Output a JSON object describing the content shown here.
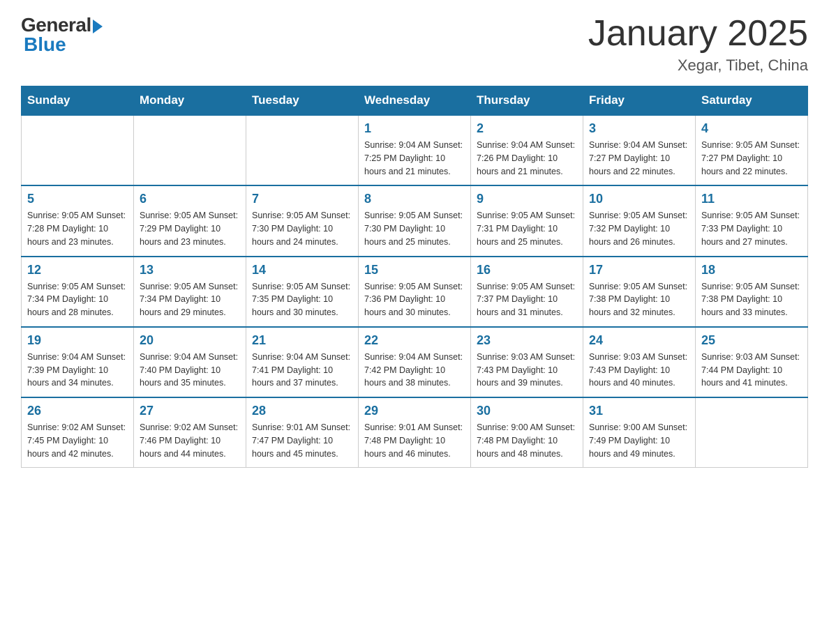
{
  "logo": {
    "general": "General",
    "blue": "Blue"
  },
  "title": "January 2025",
  "location": "Xegar, Tibet, China",
  "weekdays": [
    "Sunday",
    "Monday",
    "Tuesday",
    "Wednesday",
    "Thursday",
    "Friday",
    "Saturday"
  ],
  "weeks": [
    [
      {
        "day": "",
        "info": ""
      },
      {
        "day": "",
        "info": ""
      },
      {
        "day": "",
        "info": ""
      },
      {
        "day": "1",
        "info": "Sunrise: 9:04 AM\nSunset: 7:25 PM\nDaylight: 10 hours\nand 21 minutes."
      },
      {
        "day": "2",
        "info": "Sunrise: 9:04 AM\nSunset: 7:26 PM\nDaylight: 10 hours\nand 21 minutes."
      },
      {
        "day": "3",
        "info": "Sunrise: 9:04 AM\nSunset: 7:27 PM\nDaylight: 10 hours\nand 22 minutes."
      },
      {
        "day": "4",
        "info": "Sunrise: 9:05 AM\nSunset: 7:27 PM\nDaylight: 10 hours\nand 22 minutes."
      }
    ],
    [
      {
        "day": "5",
        "info": "Sunrise: 9:05 AM\nSunset: 7:28 PM\nDaylight: 10 hours\nand 23 minutes."
      },
      {
        "day": "6",
        "info": "Sunrise: 9:05 AM\nSunset: 7:29 PM\nDaylight: 10 hours\nand 23 minutes."
      },
      {
        "day": "7",
        "info": "Sunrise: 9:05 AM\nSunset: 7:30 PM\nDaylight: 10 hours\nand 24 minutes."
      },
      {
        "day": "8",
        "info": "Sunrise: 9:05 AM\nSunset: 7:30 PM\nDaylight: 10 hours\nand 25 minutes."
      },
      {
        "day": "9",
        "info": "Sunrise: 9:05 AM\nSunset: 7:31 PM\nDaylight: 10 hours\nand 25 minutes."
      },
      {
        "day": "10",
        "info": "Sunrise: 9:05 AM\nSunset: 7:32 PM\nDaylight: 10 hours\nand 26 minutes."
      },
      {
        "day": "11",
        "info": "Sunrise: 9:05 AM\nSunset: 7:33 PM\nDaylight: 10 hours\nand 27 minutes."
      }
    ],
    [
      {
        "day": "12",
        "info": "Sunrise: 9:05 AM\nSunset: 7:34 PM\nDaylight: 10 hours\nand 28 minutes."
      },
      {
        "day": "13",
        "info": "Sunrise: 9:05 AM\nSunset: 7:34 PM\nDaylight: 10 hours\nand 29 minutes."
      },
      {
        "day": "14",
        "info": "Sunrise: 9:05 AM\nSunset: 7:35 PM\nDaylight: 10 hours\nand 30 minutes."
      },
      {
        "day": "15",
        "info": "Sunrise: 9:05 AM\nSunset: 7:36 PM\nDaylight: 10 hours\nand 30 minutes."
      },
      {
        "day": "16",
        "info": "Sunrise: 9:05 AM\nSunset: 7:37 PM\nDaylight: 10 hours\nand 31 minutes."
      },
      {
        "day": "17",
        "info": "Sunrise: 9:05 AM\nSunset: 7:38 PM\nDaylight: 10 hours\nand 32 minutes."
      },
      {
        "day": "18",
        "info": "Sunrise: 9:05 AM\nSunset: 7:38 PM\nDaylight: 10 hours\nand 33 minutes."
      }
    ],
    [
      {
        "day": "19",
        "info": "Sunrise: 9:04 AM\nSunset: 7:39 PM\nDaylight: 10 hours\nand 34 minutes."
      },
      {
        "day": "20",
        "info": "Sunrise: 9:04 AM\nSunset: 7:40 PM\nDaylight: 10 hours\nand 35 minutes."
      },
      {
        "day": "21",
        "info": "Sunrise: 9:04 AM\nSunset: 7:41 PM\nDaylight: 10 hours\nand 37 minutes."
      },
      {
        "day": "22",
        "info": "Sunrise: 9:04 AM\nSunset: 7:42 PM\nDaylight: 10 hours\nand 38 minutes."
      },
      {
        "day": "23",
        "info": "Sunrise: 9:03 AM\nSunset: 7:43 PM\nDaylight: 10 hours\nand 39 minutes."
      },
      {
        "day": "24",
        "info": "Sunrise: 9:03 AM\nSunset: 7:43 PM\nDaylight: 10 hours\nand 40 minutes."
      },
      {
        "day": "25",
        "info": "Sunrise: 9:03 AM\nSunset: 7:44 PM\nDaylight: 10 hours\nand 41 minutes."
      }
    ],
    [
      {
        "day": "26",
        "info": "Sunrise: 9:02 AM\nSunset: 7:45 PM\nDaylight: 10 hours\nand 42 minutes."
      },
      {
        "day": "27",
        "info": "Sunrise: 9:02 AM\nSunset: 7:46 PM\nDaylight: 10 hours\nand 44 minutes."
      },
      {
        "day": "28",
        "info": "Sunrise: 9:01 AM\nSunset: 7:47 PM\nDaylight: 10 hours\nand 45 minutes."
      },
      {
        "day": "29",
        "info": "Sunrise: 9:01 AM\nSunset: 7:48 PM\nDaylight: 10 hours\nand 46 minutes."
      },
      {
        "day": "30",
        "info": "Sunrise: 9:00 AM\nSunset: 7:48 PM\nDaylight: 10 hours\nand 48 minutes."
      },
      {
        "day": "31",
        "info": "Sunrise: 9:00 AM\nSunset: 7:49 PM\nDaylight: 10 hours\nand 49 minutes."
      },
      {
        "day": "",
        "info": ""
      }
    ]
  ]
}
